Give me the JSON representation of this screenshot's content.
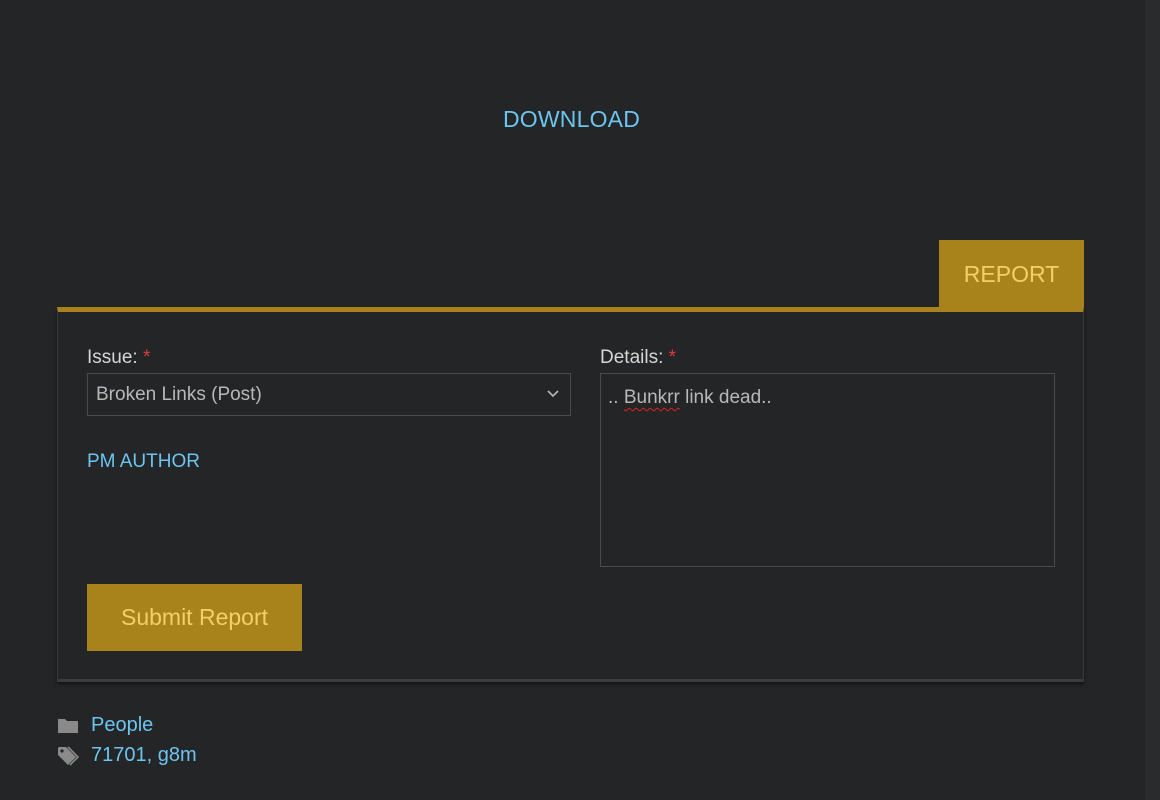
{
  "download": {
    "label": "DOWNLOAD"
  },
  "report": {
    "tab_label": "REPORT",
    "issue": {
      "label": "Issue:",
      "required_mark": "*",
      "selected_value": "Broken Links (Post)"
    },
    "details": {
      "label": "Details:",
      "required_mark": "*",
      "prefix": "..",
      "misspelled_word": "Bunkrr",
      "suffix": "link dead.."
    },
    "pm_author_label": "PM AUTHOR",
    "submit_label": "Submit Report"
  },
  "meta": {
    "category": "People",
    "tags": "71701, g8m"
  },
  "colors": {
    "background": "#242526",
    "accent_gold": "#a8831c",
    "accent_gold_text": "#f3cf6a",
    "link_blue": "#6cc5f0",
    "required_red": "#e03b3b"
  },
  "icons": {
    "select_arrow": "chevron-down-icon",
    "category": "folder-icon",
    "tags": "tag-icon"
  }
}
